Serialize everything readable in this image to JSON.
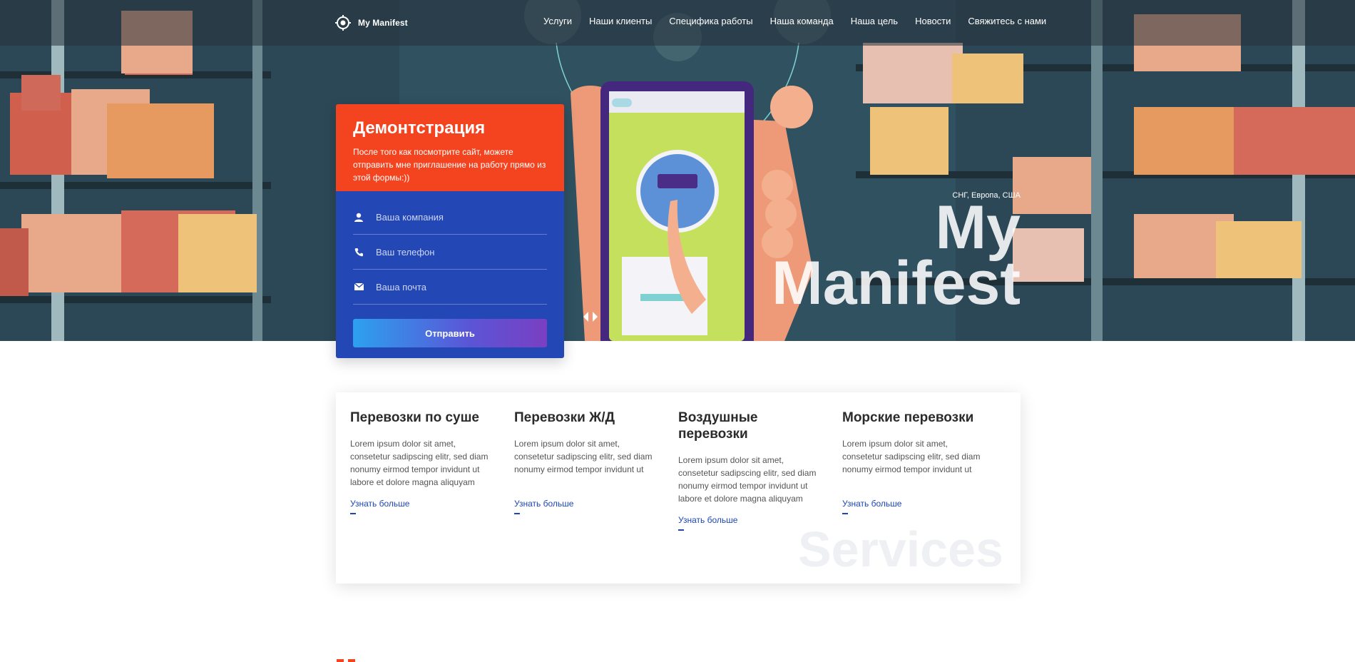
{
  "logo": {
    "text": "My Manifest"
  },
  "nav": {
    "items": [
      {
        "label": "Услуги"
      },
      {
        "label": "Наши клиенты"
      },
      {
        "label": "Специфика работы"
      },
      {
        "label": "Наша команда"
      },
      {
        "label": "Наша цель"
      },
      {
        "label": "Новости"
      },
      {
        "label": "Свяжитесь с нами"
      }
    ]
  },
  "demo": {
    "title": "Демонтстрация",
    "text": "После того как посмотрите сайт, можете отправить мне приглашение на работу прямо из этой формы:))",
    "fields": {
      "company_placeholder": "Ваша компания",
      "phone_placeholder": "Ваш телефон",
      "email_placeholder": "Ваша почта"
    },
    "submit_label": "Отправить"
  },
  "hero": {
    "subtitle": "СНГ, Европа, США",
    "title_line1": "My",
    "title_line2": "Manifest"
  },
  "services": {
    "background_word": "Services",
    "items": [
      {
        "title": "Перевозки по суше",
        "text": "Lorem ipsum dolor sit amet, consetetur sadipscing elitr, sed diam nonumy eirmod tempor invidunt ut labore et dolore magna aliquyam",
        "link": "Узнать больше"
      },
      {
        "title": "Перевозки Ж/Д",
        "text": "Lorem ipsum dolor sit amet, consetetur sadipscing elitr, sed diam nonumy eirmod tempor invidunt ut",
        "link": "Узнать больше"
      },
      {
        "title": "Воздушные перевозки",
        "text": "Lorem ipsum dolor sit amet, consetetur sadipscing elitr, sed diam nonumy eirmod tempor invidunt ut labore et dolore magna aliquyam",
        "link": "Узнать больше"
      },
      {
        "title": "Морские перевозки",
        "text": "Lorem ipsum dolor sit amet, consetetur sadipscing elitr, sed diam nonumy eirmod tempor invidunt ut",
        "link": "Узнать больше"
      }
    ]
  },
  "colors": {
    "accent_orange": "#f4441f",
    "form_blue": "#2347b5",
    "link_blue": "#1d46b3"
  },
  "icons": {
    "logo": "target-icon",
    "company": "user-icon",
    "phone": "phone-icon",
    "email": "envelope-icon"
  }
}
